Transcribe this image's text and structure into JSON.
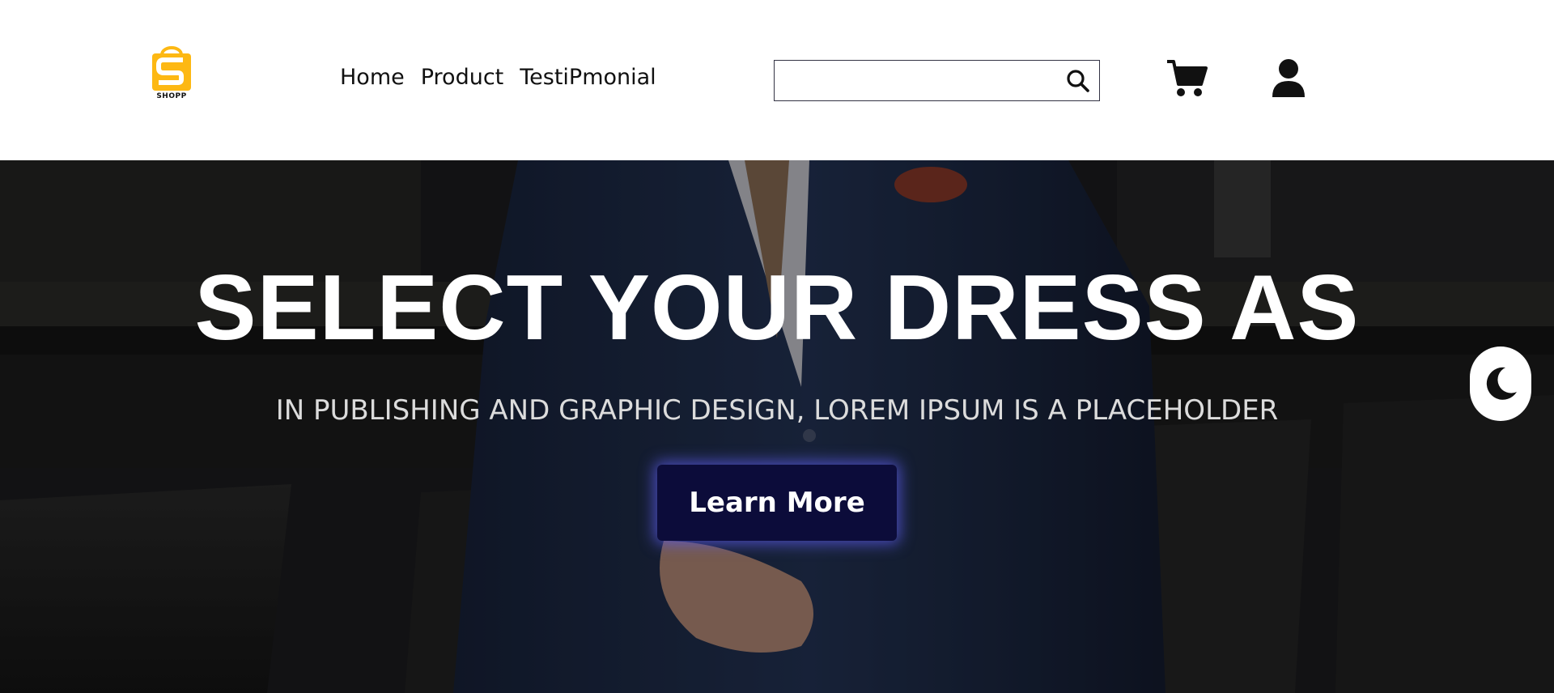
{
  "brand": {
    "logo_text": "SHOPP",
    "logo_color": "#fdb813"
  },
  "nav": {
    "items": [
      {
        "label": "Home"
      },
      {
        "label": "Product"
      },
      {
        "label": "TestiPmonial"
      }
    ]
  },
  "search": {
    "value": "",
    "placeholder": "",
    "icon": "search-icon"
  },
  "header_icons": {
    "cart": "cart-icon",
    "user": "user-icon"
  },
  "hero": {
    "title": "SELECT YOUR DRESS AS",
    "subtitle": "IN PUBLISHING AND GRAPHIC DESIGN, LOREM IPSUM IS A PLACEHOLDER",
    "cta_label": "Learn More",
    "cta_color": "#0c0c3a",
    "theme_toggle_icon": "moon-icon"
  }
}
